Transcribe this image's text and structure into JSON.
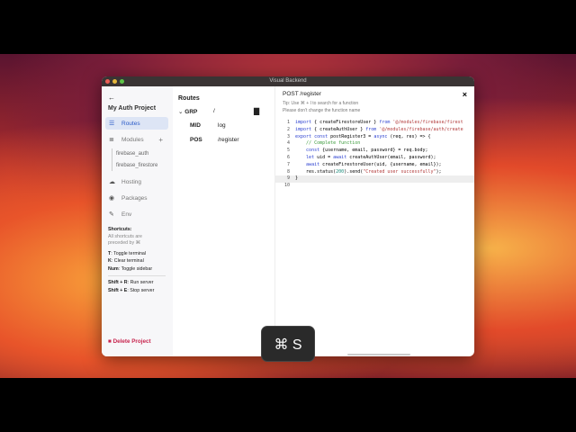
{
  "window": {
    "title": "Visual Backend"
  },
  "sidebar": {
    "back": "←",
    "project": "My Auth Project",
    "items": [
      {
        "label": "Routes",
        "icon": "routes-icon"
      },
      {
        "label": "Modules",
        "icon": "database-icon"
      },
      {
        "label": "Hosting",
        "icon": "cloud-icon"
      },
      {
        "label": "Packages",
        "icon": "package-icon"
      },
      {
        "label": "Env",
        "icon": "key-icon"
      }
    ],
    "modules": [
      "firebase_auth",
      "firebase_firestore"
    ],
    "add": "+",
    "shortcuts": {
      "title": "Shortcuts:",
      "note1": "All shortcuts are",
      "note2": "preceded by ⌘",
      "list": [
        {
          "k": "T",
          "d": ": Toggle terminal"
        },
        {
          "k": "K",
          "d": ": Clear terminal"
        },
        {
          "k": "Num",
          "d": ": Toggle sidebar"
        },
        {
          "k": "Shift + R",
          "d": ": Run server"
        },
        {
          "k": "Shift + E",
          "d": ": Stop server"
        }
      ]
    },
    "delete": "Delete Project"
  },
  "routes": {
    "title": "Routes",
    "rows": [
      {
        "type": "GRP",
        "path": "/"
      },
      {
        "type": "MID",
        "path": "log"
      },
      {
        "type": "POS",
        "path": "/register"
      }
    ]
  },
  "editor": {
    "title": "POST /register",
    "tip": "Tip: Use ⌘ + I to search for a function",
    "warn": "Please don't change the function name",
    "close": "×",
    "lines": [
      "import { createFirestoreUser } from '@/modules/firebase/firest",
      "import { createAuthUser } from '@/modules/firebase/auth/create",
      "export const postRegister3 = async (req, res) => {",
      "    // Complete function",
      "    const {username, email, password} = req.body;",
      "    let uid = await createAuthUser(email, password);",
      "    await createFirestoreUser(uid, {username, email});",
      "    res.status(200).send(\"Created user successfully\");",
      "}",
      ""
    ]
  },
  "keystroke": "⌘ S"
}
